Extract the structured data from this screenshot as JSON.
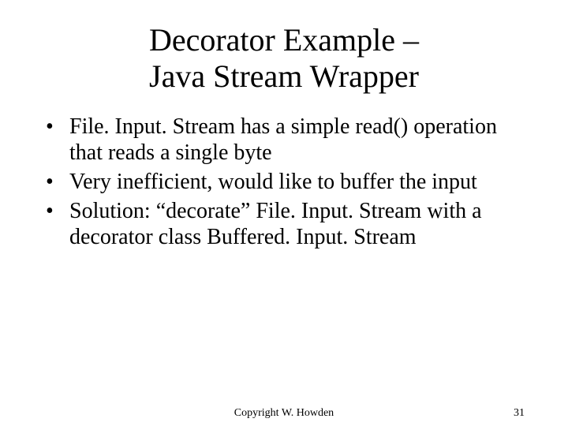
{
  "title_line1": "Decorator Example –",
  "title_line2": "Java Stream Wrapper",
  "bullets": [
    "File. Input. Stream has a simple read() operation that reads a single byte",
    "Very inefficient, would like to buffer the input",
    "Solution: “decorate” File. Input. Stream with a decorator class Buffered. Input. Stream"
  ],
  "footer": {
    "copyright": "Copyright W. Howden",
    "page_number": "31"
  }
}
